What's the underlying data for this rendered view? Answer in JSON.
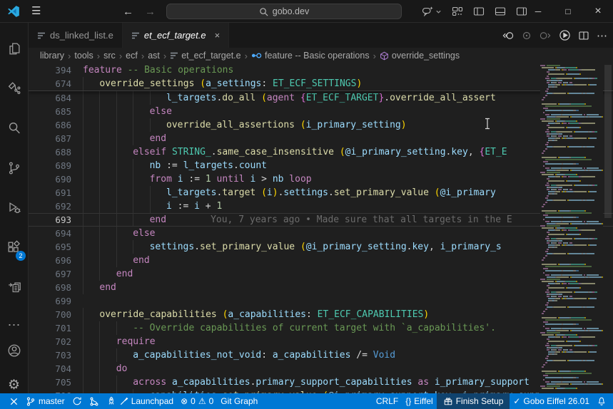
{
  "titlebar": {
    "search": "gobo.dev"
  },
  "glyphs": {
    "menu": "☰",
    "back": "←",
    "forward": "→",
    "minimize": "─",
    "maximize": "□",
    "close": "×",
    "tab_close": "×",
    "more": "⋯",
    "crumb_sep": "›",
    "error": "⊗",
    "warning": "⚠",
    "check": "✓",
    "gear": "⚙",
    "brackets": "{}"
  },
  "tabs": [
    {
      "label": "ds_linked_list.e",
      "active": false
    },
    {
      "label": "et_ecf_target.e",
      "active": true
    }
  ],
  "activity": {
    "extensions_badge": "2"
  },
  "breadcrumb": [
    {
      "label": "library"
    },
    {
      "label": "tools"
    },
    {
      "label": "src"
    },
    {
      "label": "ecf"
    },
    {
      "label": "ast"
    },
    {
      "label": "et_ecf_target.e",
      "icon": "file"
    },
    {
      "label": "feature -- Basic operations",
      "icon": "method"
    },
    {
      "label": "override_settings",
      "icon": "cube"
    }
  ],
  "editor": {
    "sticky_lines": [
      {
        "num": "394",
        "indent": 0,
        "tokens": [
          [
            "feature",
            "kw"
          ],
          [
            " ",
            "pl"
          ],
          [
            "-- Basic operations",
            "cmt"
          ]
        ]
      },
      {
        "num": "674",
        "indent": 1,
        "tokens": [
          [
            "override_settings",
            "fn"
          ],
          [
            " ",
            "pl"
          ],
          [
            "(",
            "b1"
          ],
          [
            "a_settings",
            "var"
          ],
          [
            ": ",
            "pl"
          ],
          [
            "ET_ECF_SETTINGS",
            "type"
          ],
          [
            ")",
            "b1"
          ]
        ]
      }
    ],
    "lines": [
      {
        "num": "684",
        "indent": 5,
        "tokens": [
          [
            "l_targets",
            "var"
          ],
          [
            ".",
            "pl"
          ],
          [
            "do_all",
            "fn"
          ],
          [
            " ",
            "pl"
          ],
          [
            "(",
            "b1"
          ],
          [
            "agent",
            "kw"
          ],
          [
            " ",
            "pl"
          ],
          [
            "{",
            "b2"
          ],
          [
            "ET_ECF_TARGET",
            "type"
          ],
          [
            "}",
            "b2"
          ],
          [
            ".",
            "pl"
          ],
          [
            "override_all_assert",
            "fn"
          ]
        ]
      },
      {
        "num": "685",
        "indent": 4,
        "tokens": [
          [
            "else",
            "kw"
          ]
        ]
      },
      {
        "num": "686",
        "indent": 5,
        "tokens": [
          [
            "override_all_assertions",
            "fn"
          ],
          [
            " ",
            "pl"
          ],
          [
            "(",
            "b1"
          ],
          [
            "i_primary_setting",
            "var"
          ],
          [
            ")",
            "b1"
          ]
        ]
      },
      {
        "num": "687",
        "indent": 4,
        "tokens": [
          [
            "end",
            "kw"
          ]
        ]
      },
      {
        "num": "688",
        "indent": 3,
        "tokens": [
          [
            "elseif",
            "kw"
          ],
          [
            " ",
            "pl"
          ],
          [
            "STRING_",
            "type"
          ],
          [
            ".",
            "pl"
          ],
          [
            "same_case_insensitive",
            "fn"
          ],
          [
            " ",
            "pl"
          ],
          [
            "(",
            "b1"
          ],
          [
            "@i_primary_setting",
            "var"
          ],
          [
            ".",
            "pl"
          ],
          [
            "key",
            "var"
          ],
          [
            ", ",
            "pl"
          ],
          [
            "{",
            "b2"
          ],
          [
            "ET_E",
            "type"
          ]
        ]
      },
      {
        "num": "689",
        "indent": 4,
        "tokens": [
          [
            "nb",
            "var"
          ],
          [
            " := ",
            "pl"
          ],
          [
            "l_targets",
            "var"
          ],
          [
            ".",
            "pl"
          ],
          [
            "count",
            "var"
          ]
        ]
      },
      {
        "num": "690",
        "indent": 4,
        "tokens": [
          [
            "from",
            "kw"
          ],
          [
            " ",
            "pl"
          ],
          [
            "i",
            "var"
          ],
          [
            " := ",
            "pl"
          ],
          [
            "1",
            "num"
          ],
          [
            " ",
            "pl"
          ],
          [
            "until",
            "kw"
          ],
          [
            " ",
            "pl"
          ],
          [
            "i",
            "var"
          ],
          [
            " > ",
            "pl"
          ],
          [
            "nb",
            "var"
          ],
          [
            " ",
            "pl"
          ],
          [
            "loop",
            "kw"
          ]
        ]
      },
      {
        "num": "691",
        "indent": 5,
        "tokens": [
          [
            "l_targets",
            "var"
          ],
          [
            ".",
            "pl"
          ],
          [
            "target",
            "fn"
          ],
          [
            " ",
            "pl"
          ],
          [
            "(",
            "b1"
          ],
          [
            "i",
            "var"
          ],
          [
            ")",
            "b1"
          ],
          [
            ".",
            "pl"
          ],
          [
            "settings",
            "var"
          ],
          [
            ".",
            "pl"
          ],
          [
            "set_primary_value",
            "fn"
          ],
          [
            " ",
            "pl"
          ],
          [
            "(",
            "b1"
          ],
          [
            "@i_primary",
            "var"
          ]
        ]
      },
      {
        "num": "692",
        "indent": 5,
        "tokens": [
          [
            "i",
            "var"
          ],
          [
            " := ",
            "pl"
          ],
          [
            "i",
            "var"
          ],
          [
            " + ",
            "pl"
          ],
          [
            "1",
            "num"
          ]
        ]
      },
      {
        "num": "693",
        "indent": 4,
        "current": true,
        "tokens": [
          [
            "end",
            "kw"
          ]
        ],
        "blame": "You, 7 years ago • Made sure that all targets in the E"
      },
      {
        "num": "694",
        "indent": 3,
        "tokens": [
          [
            "else",
            "kw"
          ]
        ]
      },
      {
        "num": "695",
        "indent": 4,
        "tokens": [
          [
            "settings",
            "var"
          ],
          [
            ".",
            "pl"
          ],
          [
            "set_primary_value",
            "fn"
          ],
          [
            " ",
            "pl"
          ],
          [
            "(",
            "b1"
          ],
          [
            "@i_primary_setting",
            "var"
          ],
          [
            ".",
            "pl"
          ],
          [
            "key",
            "var"
          ],
          [
            ", ",
            "pl"
          ],
          [
            "i_primary_s",
            "var"
          ]
        ]
      },
      {
        "num": "696",
        "indent": 3,
        "tokens": [
          [
            "end",
            "kw"
          ]
        ]
      },
      {
        "num": "697",
        "indent": 2,
        "tokens": [
          [
            "end",
            "kw"
          ]
        ]
      },
      {
        "num": "698",
        "indent": 1,
        "tokens": [
          [
            "end",
            "kw"
          ]
        ]
      },
      {
        "num": "699",
        "indent": 0,
        "tokens": []
      },
      {
        "num": "700",
        "indent": 1,
        "tokens": [
          [
            "override_capabilities",
            "fn"
          ],
          [
            " ",
            "pl"
          ],
          [
            "(",
            "b1"
          ],
          [
            "a_capabilities",
            "var"
          ],
          [
            ": ",
            "pl"
          ],
          [
            "ET_ECF_CAPABILITIES",
            "type"
          ],
          [
            ")",
            "b1"
          ]
        ]
      },
      {
        "num": "701",
        "indent": 3,
        "tokens": [
          [
            "-- Override capabilities of current target with `a_capabilities'.",
            "cmt"
          ]
        ]
      },
      {
        "num": "702",
        "indent": 2,
        "tokens": [
          [
            "require",
            "kw"
          ]
        ]
      },
      {
        "num": "703",
        "indent": 3,
        "tokens": [
          [
            "a_capabilities_not_void",
            "var"
          ],
          [
            ": ",
            "pl"
          ],
          [
            "a_capabilities",
            "var"
          ],
          [
            " /= ",
            "pl"
          ],
          [
            "Void",
            "void"
          ]
        ]
      },
      {
        "num": "704",
        "indent": 2,
        "tokens": [
          [
            "do",
            "kw"
          ]
        ]
      },
      {
        "num": "705",
        "indent": 3,
        "tokens": [
          [
            "across",
            "kw"
          ],
          [
            " ",
            "pl"
          ],
          [
            "a_capabilities",
            "var"
          ],
          [
            ".",
            "pl"
          ],
          [
            "primary_support_capabilities",
            "var"
          ],
          [
            " ",
            "pl"
          ],
          [
            "as",
            "kw"
          ],
          [
            " ",
            "pl"
          ],
          [
            "i_primary_support",
            "var"
          ]
        ]
      },
      {
        "num": "706",
        "indent": 4,
        "sliver": true,
        "tokens": [
          [
            "capabilities",
            "var"
          ],
          [
            ".",
            "pl"
          ],
          [
            "set_primary_value",
            "fn"
          ],
          [
            " ",
            "pl"
          ],
          [
            "(",
            "b1"
          ],
          [
            "@i_primary_support",
            "var"
          ],
          [
            ".",
            "pl"
          ],
          [
            "key",
            "var"
          ],
          [
            ", ",
            "pl"
          ],
          [
            "i_primary_support",
            "var"
          ],
          [
            ")",
            "b1"
          ]
        ]
      }
    ]
  },
  "statusbar": {
    "branch": "master",
    "launchpad": "Launchpad",
    "errors": "0",
    "warnings": "0",
    "git_graph": "Git Graph",
    "eol": "CRLF",
    "language": "Eiffel",
    "finish_setup": "Finish Setup",
    "env": "Gobo Eiffel 26.01"
  },
  "colors": {
    "statusbar_bg": "#0078d4",
    "statusbar_prominent_bg": "#10436e",
    "badge_bg": "#0078d4",
    "editor_bg": "#1f1f1f",
    "chrome_bg": "#181818"
  }
}
